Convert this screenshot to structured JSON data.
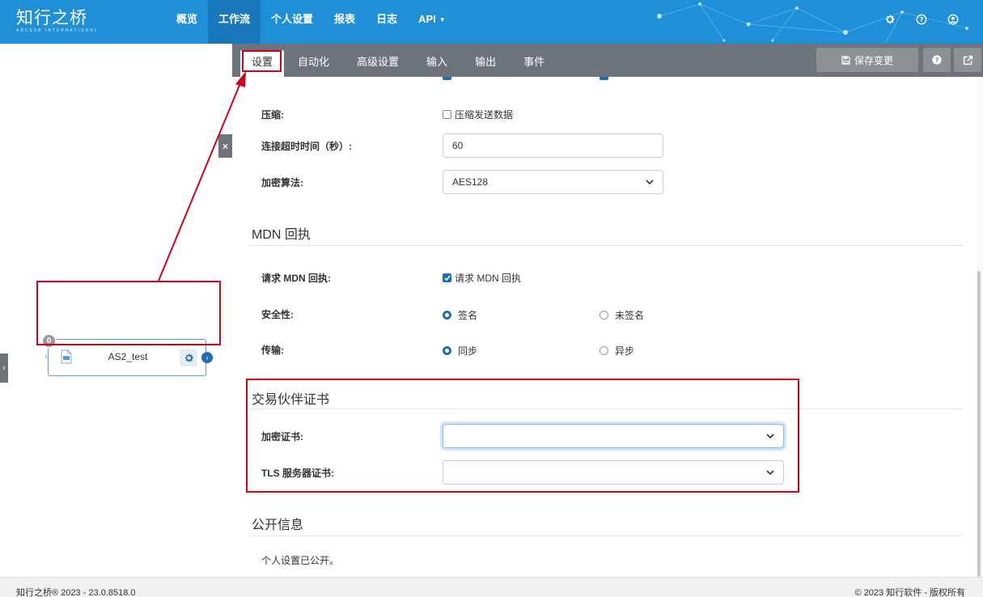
{
  "app": {
    "logo_text": "知行之桥",
    "logo_subtext": "ARCESB INTERNATIONAL"
  },
  "nav": {
    "items": [
      {
        "label": "概览"
      },
      {
        "label": "工作流",
        "active": true
      },
      {
        "label": "个人设置"
      },
      {
        "label": "报表"
      },
      {
        "label": "日志"
      },
      {
        "label": "API",
        "dropdown": true
      }
    ],
    "icons": [
      "gear-icon",
      "help-icon",
      "user-icon"
    ]
  },
  "canvas": {
    "close_label": "×",
    "node": {
      "title": "AS2_test",
      "badge": "0",
      "icon": "file-icon",
      "gear": "gear-icon"
    }
  },
  "panel": {
    "tabs": [
      {
        "label": "设置",
        "active": true
      },
      {
        "label": "自动化"
      },
      {
        "label": "高级设置"
      },
      {
        "label": "输入"
      },
      {
        "label": "输出"
      },
      {
        "label": "事件"
      }
    ],
    "save_label": "保存变更",
    "rows": {
      "compress": {
        "label": "压缩:",
        "option": "压缩发送数据",
        "checked": false
      },
      "timeout": {
        "label": "连接超时时间（秒）:",
        "value": "60"
      },
      "encryption": {
        "label": "加密算法:",
        "value": "AES128"
      }
    },
    "mdn": {
      "title": "MDN 回执",
      "request": {
        "label": "请求 MDN 回执:",
        "option": "请求 MDN 回执",
        "checked": true
      },
      "security": {
        "label": "安全性:",
        "option_a": "签名",
        "option_b": "未签名",
        "selected": "签名"
      },
      "transport": {
        "label": "传输:",
        "option_a": "同步",
        "option_b": "异步",
        "selected": "同步"
      }
    },
    "certs": {
      "title": "交易伙伴证书",
      "encryption_cert": {
        "label": "加密证书:",
        "value": ""
      },
      "tls_cert": {
        "label": "TLS 服务器证书:",
        "value": ""
      }
    },
    "public": {
      "title": "公开信息",
      "text": "个人设置已公开。"
    }
  },
  "footer": {
    "left": "知行之桥® 2023 - 23.0.8518.0",
    "right": "© 2023 知行软件 - 版权所有"
  },
  "colors": {
    "nav_bg": "#1f8fd8",
    "nav_active": "#1878bb",
    "tabbar_bg": "#6d737a",
    "accent": "#1f6eb5",
    "highlight": "#d0021b"
  }
}
